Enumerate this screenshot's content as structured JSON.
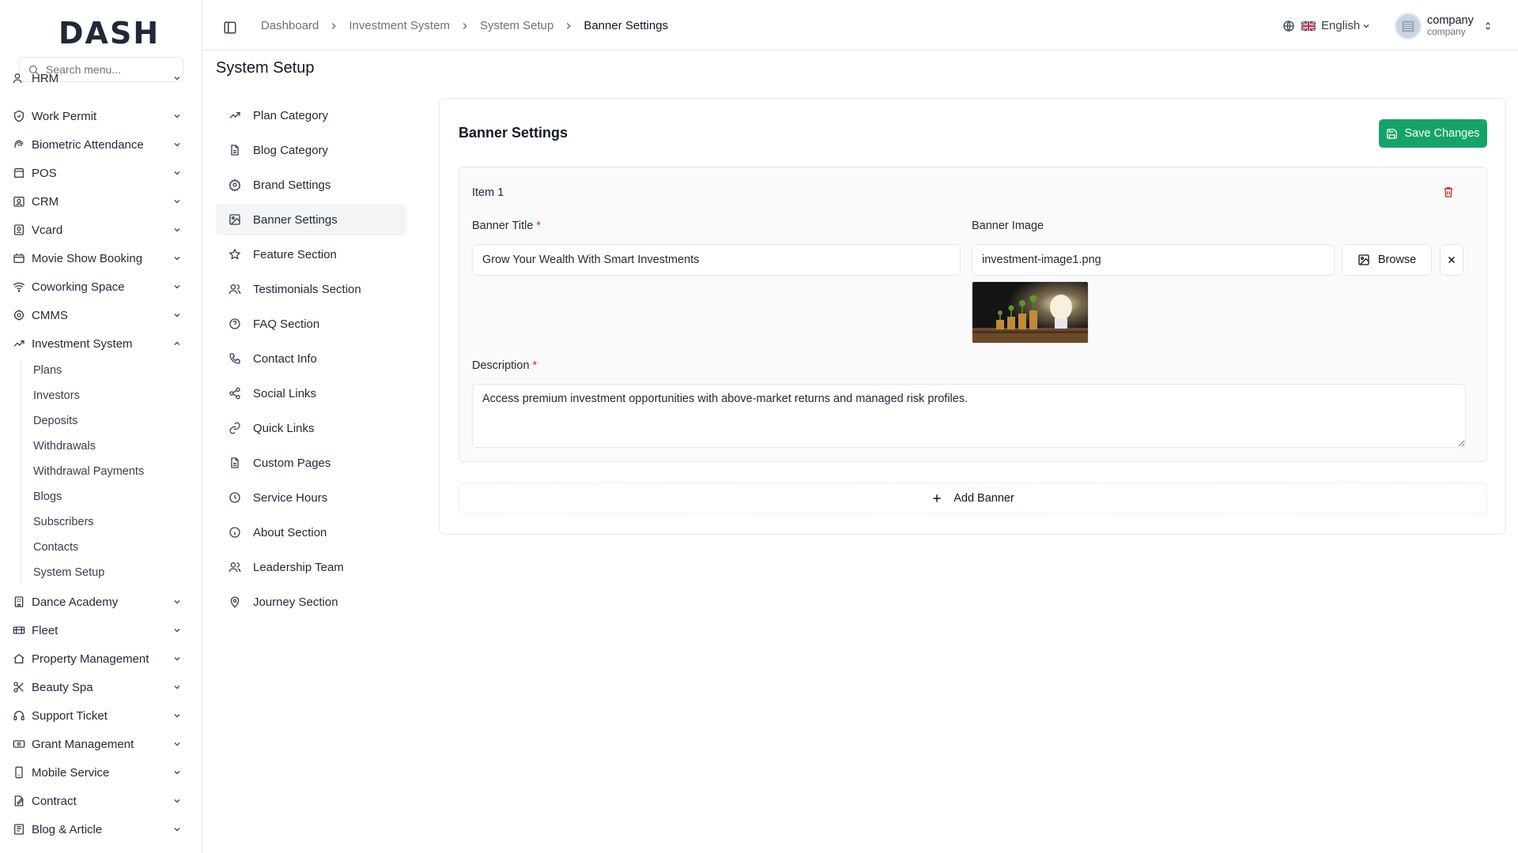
{
  "brand": {
    "logo_text": "DASH"
  },
  "search": {
    "placeholder": "Search menu..."
  },
  "sidebar": {
    "items": [
      {
        "label": "HRM",
        "icon": "users-icon"
      },
      {
        "label": "Work Permit",
        "icon": "shield-icon"
      },
      {
        "label": "Biometric Attendance",
        "icon": "fingerprint-icon"
      },
      {
        "label": "POS",
        "icon": "store-icon"
      },
      {
        "label": "CRM",
        "icon": "contact-icon"
      },
      {
        "label": "Vcard",
        "icon": "id-card-icon"
      },
      {
        "label": "Movie Show Booking",
        "icon": "ticket-icon"
      },
      {
        "label": "Coworking Space",
        "icon": "wifi-icon"
      },
      {
        "label": "CMMS",
        "icon": "cog-icon"
      },
      {
        "label": "Investment System",
        "icon": "trending-up-icon"
      },
      {
        "label": "Dance Academy",
        "icon": "building-icon"
      },
      {
        "label": "Fleet",
        "icon": "truck-icon"
      },
      {
        "label": "Property Management",
        "icon": "home-icon"
      },
      {
        "label": "Beauty Spa",
        "icon": "scissors-icon"
      },
      {
        "label": "Support Ticket",
        "icon": "headset-icon"
      },
      {
        "label": "Grant Management",
        "icon": "banknote-icon"
      },
      {
        "label": "Mobile Service",
        "icon": "smartphone-icon"
      },
      {
        "label": "Contract",
        "icon": "file-signature-icon"
      },
      {
        "label": "Blog & Article",
        "icon": "newspaper-icon"
      }
    ],
    "investment_sub": [
      "Plans",
      "Investors",
      "Deposits",
      "Withdrawals",
      "Withdrawal Payments",
      "Blogs",
      "Subscribers",
      "Contacts",
      "System Setup"
    ]
  },
  "header": {
    "breadcrumb": [
      "Dashboard",
      "Investment System",
      "System Setup",
      "Banner Settings"
    ],
    "language": "English",
    "user": {
      "name": "company",
      "role": "company"
    }
  },
  "page": {
    "title": "System Setup"
  },
  "setup_nav": {
    "items": [
      {
        "label": "Plan Category",
        "icon": "trending-up-icon"
      },
      {
        "label": "Blog Category",
        "icon": "file-text-icon"
      },
      {
        "label": "Brand Settings",
        "icon": "settings-icon"
      },
      {
        "label": "Banner Settings",
        "icon": "image-icon",
        "active": true
      },
      {
        "label": "Feature Section",
        "icon": "star-icon"
      },
      {
        "label": "Testimonials Section",
        "icon": "users-icon"
      },
      {
        "label": "FAQ Section",
        "icon": "help-circle-icon"
      },
      {
        "label": "Contact Info",
        "icon": "phone-icon"
      },
      {
        "label": "Social Links",
        "icon": "share-icon"
      },
      {
        "label": "Quick Links",
        "icon": "link-icon"
      },
      {
        "label": "Custom Pages",
        "icon": "file-text-icon"
      },
      {
        "label": "Service Hours",
        "icon": "clock-icon"
      },
      {
        "label": "About Section",
        "icon": "info-icon"
      },
      {
        "label": "Leadership Team",
        "icon": "users-icon"
      },
      {
        "label": "Journey Section",
        "icon": "map-pin-icon"
      }
    ]
  },
  "banner": {
    "card_title": "Banner Settings",
    "save_label": "Save Changes",
    "item_label": "Item 1",
    "title_label": "Banner Title",
    "title_value": "Grow Your Wealth With Smart Investments",
    "image_label": "Banner Image",
    "image_value": "investment-image1.png",
    "browse_label": "Browse",
    "description_label": "Description",
    "description_value": "Access premium investment opportunities with above-market returns and managed risk profiles.",
    "add_label": "Add Banner",
    "required_mark": "*"
  },
  "colors": {
    "primary": "#16a36a",
    "danger": "#dc2626",
    "border": "#e5e7eb",
    "active_bg": "#f3f4f6"
  }
}
